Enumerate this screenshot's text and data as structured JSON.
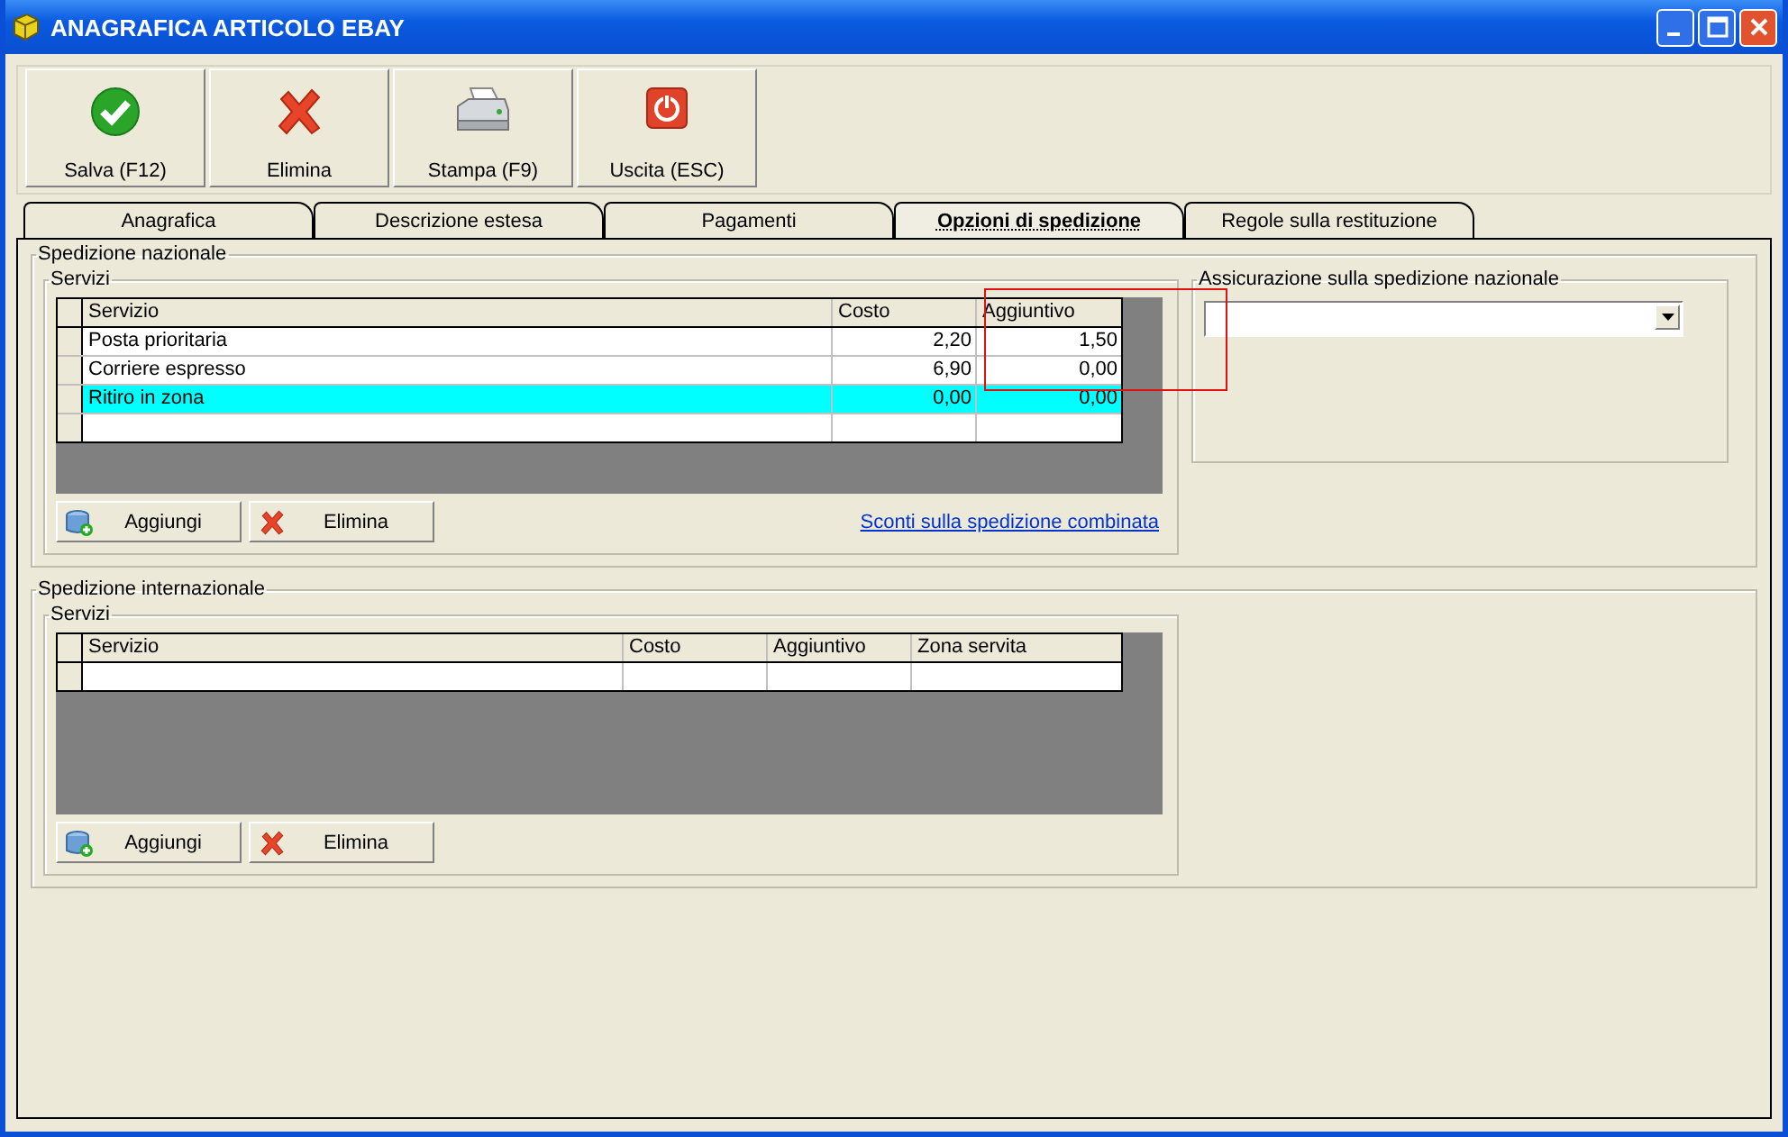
{
  "window": {
    "title": "ANAGRAFICA ARTICOLO EBAY"
  },
  "toolbar": [
    {
      "kind": "save",
      "label": "Salva (F12)"
    },
    {
      "kind": "delete",
      "label": "Elimina"
    },
    {
      "kind": "print",
      "label": "Stampa (F9)"
    },
    {
      "kind": "exit",
      "label": "Uscita (ESC)"
    }
  ],
  "tabs": [
    {
      "label": "Anagrafica",
      "selected": false
    },
    {
      "label": "Descrizione estesa",
      "selected": false
    },
    {
      "label": "Pagamenti",
      "selected": false
    },
    {
      "label": "Opzioni di spedizione",
      "selected": true
    },
    {
      "label": "Regole sulla restituzione",
      "selected": false
    }
  ],
  "national": {
    "title": "Spedizione nazionale",
    "services": {
      "title": "Servizi",
      "columns": [
        "Servizio",
        "Costo",
        "Aggiuntivo"
      ],
      "rows": [
        {
          "cells": [
            "Posta prioritaria",
            "2,20",
            "1,50"
          ],
          "selected": false
        },
        {
          "cells": [
            "Corriere espresso",
            "6,90",
            "0,00"
          ],
          "selected": false
        },
        {
          "cells": [
            "Ritiro in zona",
            "0,00",
            "0,00"
          ],
          "selected": true
        }
      ],
      "buttons": [
        {
          "kind": "add",
          "label": "Aggiungi"
        },
        {
          "kind": "delete",
          "label": "Elimina"
        }
      ],
      "link": "Sconti sulla spedizione combinata"
    },
    "insurance": {
      "title": "Assicurazione sulla spedizione nazionale"
    }
  },
  "international": {
    "title": "Spedizione internazionale",
    "services": {
      "title": "Servizi",
      "columns": [
        "Servizio",
        "Costo",
        "Aggiuntivo",
        "Zona servita"
      ],
      "buttons": [
        {
          "kind": "add",
          "label": "Aggiungi"
        },
        {
          "kind": "delete",
          "label": "Elimina"
        }
      ]
    }
  }
}
